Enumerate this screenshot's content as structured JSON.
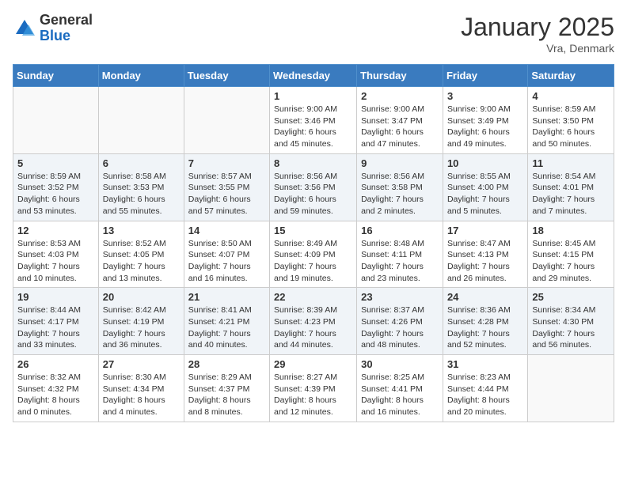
{
  "logo": {
    "general": "General",
    "blue": "Blue"
  },
  "title": "January 2025",
  "location": "Vra, Denmark",
  "weekdays": [
    "Sunday",
    "Monday",
    "Tuesday",
    "Wednesday",
    "Thursday",
    "Friday",
    "Saturday"
  ],
  "weeks": [
    [
      {
        "day": "",
        "info": ""
      },
      {
        "day": "",
        "info": ""
      },
      {
        "day": "",
        "info": ""
      },
      {
        "day": "1",
        "info": "Sunrise: 9:00 AM\nSunset: 3:46 PM\nDaylight: 6 hours\nand 45 minutes."
      },
      {
        "day": "2",
        "info": "Sunrise: 9:00 AM\nSunset: 3:47 PM\nDaylight: 6 hours\nand 47 minutes."
      },
      {
        "day": "3",
        "info": "Sunrise: 9:00 AM\nSunset: 3:49 PM\nDaylight: 6 hours\nand 49 minutes."
      },
      {
        "day": "4",
        "info": "Sunrise: 8:59 AM\nSunset: 3:50 PM\nDaylight: 6 hours\nand 50 minutes."
      }
    ],
    [
      {
        "day": "5",
        "info": "Sunrise: 8:59 AM\nSunset: 3:52 PM\nDaylight: 6 hours\nand 53 minutes."
      },
      {
        "day": "6",
        "info": "Sunrise: 8:58 AM\nSunset: 3:53 PM\nDaylight: 6 hours\nand 55 minutes."
      },
      {
        "day": "7",
        "info": "Sunrise: 8:57 AM\nSunset: 3:55 PM\nDaylight: 6 hours\nand 57 minutes."
      },
      {
        "day": "8",
        "info": "Sunrise: 8:56 AM\nSunset: 3:56 PM\nDaylight: 6 hours\nand 59 minutes."
      },
      {
        "day": "9",
        "info": "Sunrise: 8:56 AM\nSunset: 3:58 PM\nDaylight: 7 hours\nand 2 minutes."
      },
      {
        "day": "10",
        "info": "Sunrise: 8:55 AM\nSunset: 4:00 PM\nDaylight: 7 hours\nand 5 minutes."
      },
      {
        "day": "11",
        "info": "Sunrise: 8:54 AM\nSunset: 4:01 PM\nDaylight: 7 hours\nand 7 minutes."
      }
    ],
    [
      {
        "day": "12",
        "info": "Sunrise: 8:53 AM\nSunset: 4:03 PM\nDaylight: 7 hours\nand 10 minutes."
      },
      {
        "day": "13",
        "info": "Sunrise: 8:52 AM\nSunset: 4:05 PM\nDaylight: 7 hours\nand 13 minutes."
      },
      {
        "day": "14",
        "info": "Sunrise: 8:50 AM\nSunset: 4:07 PM\nDaylight: 7 hours\nand 16 minutes."
      },
      {
        "day": "15",
        "info": "Sunrise: 8:49 AM\nSunset: 4:09 PM\nDaylight: 7 hours\nand 19 minutes."
      },
      {
        "day": "16",
        "info": "Sunrise: 8:48 AM\nSunset: 4:11 PM\nDaylight: 7 hours\nand 23 minutes."
      },
      {
        "day": "17",
        "info": "Sunrise: 8:47 AM\nSunset: 4:13 PM\nDaylight: 7 hours\nand 26 minutes."
      },
      {
        "day": "18",
        "info": "Sunrise: 8:45 AM\nSunset: 4:15 PM\nDaylight: 7 hours\nand 29 minutes."
      }
    ],
    [
      {
        "day": "19",
        "info": "Sunrise: 8:44 AM\nSunset: 4:17 PM\nDaylight: 7 hours\nand 33 minutes."
      },
      {
        "day": "20",
        "info": "Sunrise: 8:42 AM\nSunset: 4:19 PM\nDaylight: 7 hours\nand 36 minutes."
      },
      {
        "day": "21",
        "info": "Sunrise: 8:41 AM\nSunset: 4:21 PM\nDaylight: 7 hours\nand 40 minutes."
      },
      {
        "day": "22",
        "info": "Sunrise: 8:39 AM\nSunset: 4:23 PM\nDaylight: 7 hours\nand 44 minutes."
      },
      {
        "day": "23",
        "info": "Sunrise: 8:37 AM\nSunset: 4:26 PM\nDaylight: 7 hours\nand 48 minutes."
      },
      {
        "day": "24",
        "info": "Sunrise: 8:36 AM\nSunset: 4:28 PM\nDaylight: 7 hours\nand 52 minutes."
      },
      {
        "day": "25",
        "info": "Sunrise: 8:34 AM\nSunset: 4:30 PM\nDaylight: 7 hours\nand 56 minutes."
      }
    ],
    [
      {
        "day": "26",
        "info": "Sunrise: 8:32 AM\nSunset: 4:32 PM\nDaylight: 8 hours\nand 0 minutes."
      },
      {
        "day": "27",
        "info": "Sunrise: 8:30 AM\nSunset: 4:34 PM\nDaylight: 8 hours\nand 4 minutes."
      },
      {
        "day": "28",
        "info": "Sunrise: 8:29 AM\nSunset: 4:37 PM\nDaylight: 8 hours\nand 8 minutes."
      },
      {
        "day": "29",
        "info": "Sunrise: 8:27 AM\nSunset: 4:39 PM\nDaylight: 8 hours\nand 12 minutes."
      },
      {
        "day": "30",
        "info": "Sunrise: 8:25 AM\nSunset: 4:41 PM\nDaylight: 8 hours\nand 16 minutes."
      },
      {
        "day": "31",
        "info": "Sunrise: 8:23 AM\nSunset: 4:44 PM\nDaylight: 8 hours\nand 20 minutes."
      },
      {
        "day": "",
        "info": ""
      }
    ]
  ]
}
